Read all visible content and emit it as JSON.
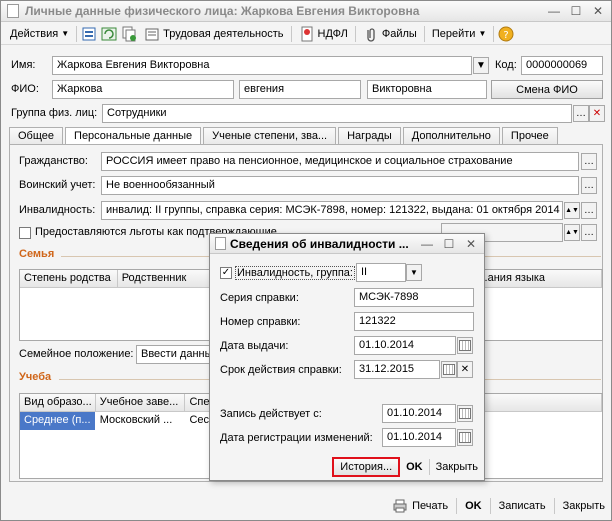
{
  "window": {
    "title": "Личные данные физического лица: Жаркова Евгения Викторовна"
  },
  "toolbar": {
    "actions_label": "Действия",
    "work_label": "Трудовая деятельность",
    "ndfl_label": "НДФЛ",
    "files_label": "Файлы",
    "goto_label": "Перейти"
  },
  "header": {
    "name_label": "Имя:",
    "name_value": "Жаркова Евгения Викторовна",
    "code_label": "Код:",
    "code_value": "0000000069",
    "fio_label": "ФИО:",
    "surname": "Жаркова",
    "firstname": "евгения",
    "patronymic": "Викторовна",
    "change_fio_label": "Смена ФИО",
    "group_label": "Группа физ. лиц:",
    "group_value": "Сотрудники"
  },
  "tabs": [
    {
      "label": "Общее"
    },
    {
      "label": "Персональные данные"
    },
    {
      "label": "Ученые степени, зва..."
    },
    {
      "label": "Награды"
    },
    {
      "label": "Дополнительно"
    },
    {
      "label": "Прочее"
    }
  ],
  "personal": {
    "citizenship_label": "Гражданство:",
    "citizenship_value": "РОССИЯ имеет право на пенсионное, медицинское и социальное страхование",
    "military_label": "Воинский учет:",
    "military_value": "Не военнообязанный",
    "disability_label": "Инвалидность:",
    "disability_value": "инвалид: II группы, справка серия: МСЭК-7898, номер: 121322, выдана: 01 октября 2014",
    "benefits_label": "Предоставляются льготы как подтверждающие...",
    "family_title": "Семья",
    "family_cols": [
      "Степень родства",
      "Родственник",
      "...ания языка"
    ],
    "marital_label": "Семейное положение:",
    "marital_value": "Ввести данны",
    "study_title": "Учеба",
    "study_cols": [
      "Вид образо...",
      "Учебное заве...",
      "Спе"
    ],
    "study_row": [
      "Среднее (п...",
      "Московский ...",
      "Сес"
    ]
  },
  "bottom": {
    "print_label": "Печать",
    "ok_label": "OK",
    "save_label": "Записать",
    "close_label": "Закрыть"
  },
  "dialog": {
    "title": "Сведения об инвалидности ...",
    "disability_group_label": "Инвалидность, группа:",
    "disability_group_value": "II",
    "series_label": "Серия справки:",
    "series_value": "МСЭК-7898",
    "number_label": "Номер справки:",
    "number_value": "121322",
    "issue_date_label": "Дата выдачи:",
    "issue_date_value": "01.10.2014",
    "valid_label": "Срок действия справки:",
    "valid_value": "31.12.2015",
    "effective_label": "Запись действует с:",
    "effective_value": "01.10.2014",
    "reg_label": "Дата регистрации изменений:",
    "reg_value": "01.10.2014",
    "history_label": "История...",
    "ok_label": "OK",
    "close_label": "Закрыть"
  },
  "colors": {
    "section_title": "#d0661a",
    "selection": "#4a78c8",
    "highlight_border": "#e0101a"
  }
}
